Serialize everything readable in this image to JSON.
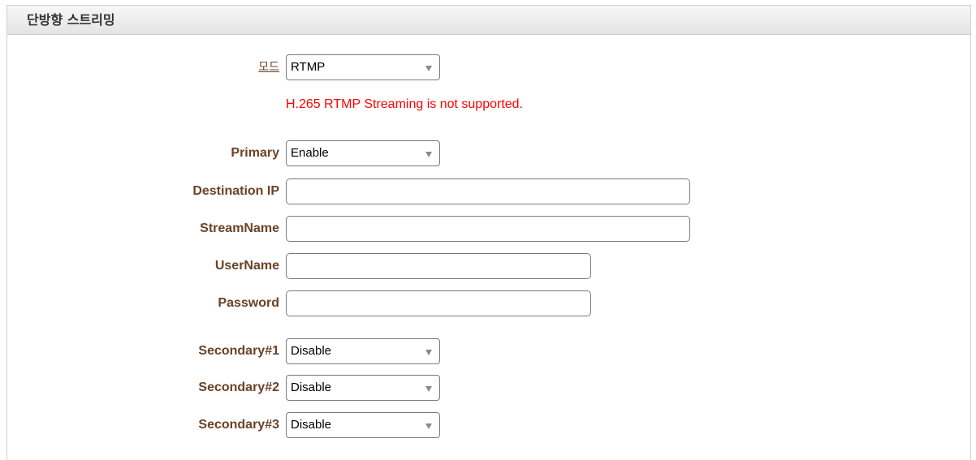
{
  "panel": {
    "title": "단방향 스트리밍"
  },
  "mode": {
    "label": "모드",
    "value": "RTMP"
  },
  "error_message": "H.265 RTMP Streaming is not supported.",
  "primary": {
    "label": "Primary",
    "value": "Enable"
  },
  "destination_ip": {
    "label": "Destination IP",
    "value": ""
  },
  "stream_name": {
    "label": "StreamName",
    "value": ""
  },
  "user_name": {
    "label": "UserName",
    "value": ""
  },
  "password": {
    "label": "Password",
    "value": ""
  },
  "secondary1": {
    "label": "Secondary#1",
    "value": "Disable"
  },
  "secondary2": {
    "label": "Secondary#2",
    "value": "Disable"
  },
  "secondary3": {
    "label": "Secondary#3",
    "value": "Disable"
  }
}
